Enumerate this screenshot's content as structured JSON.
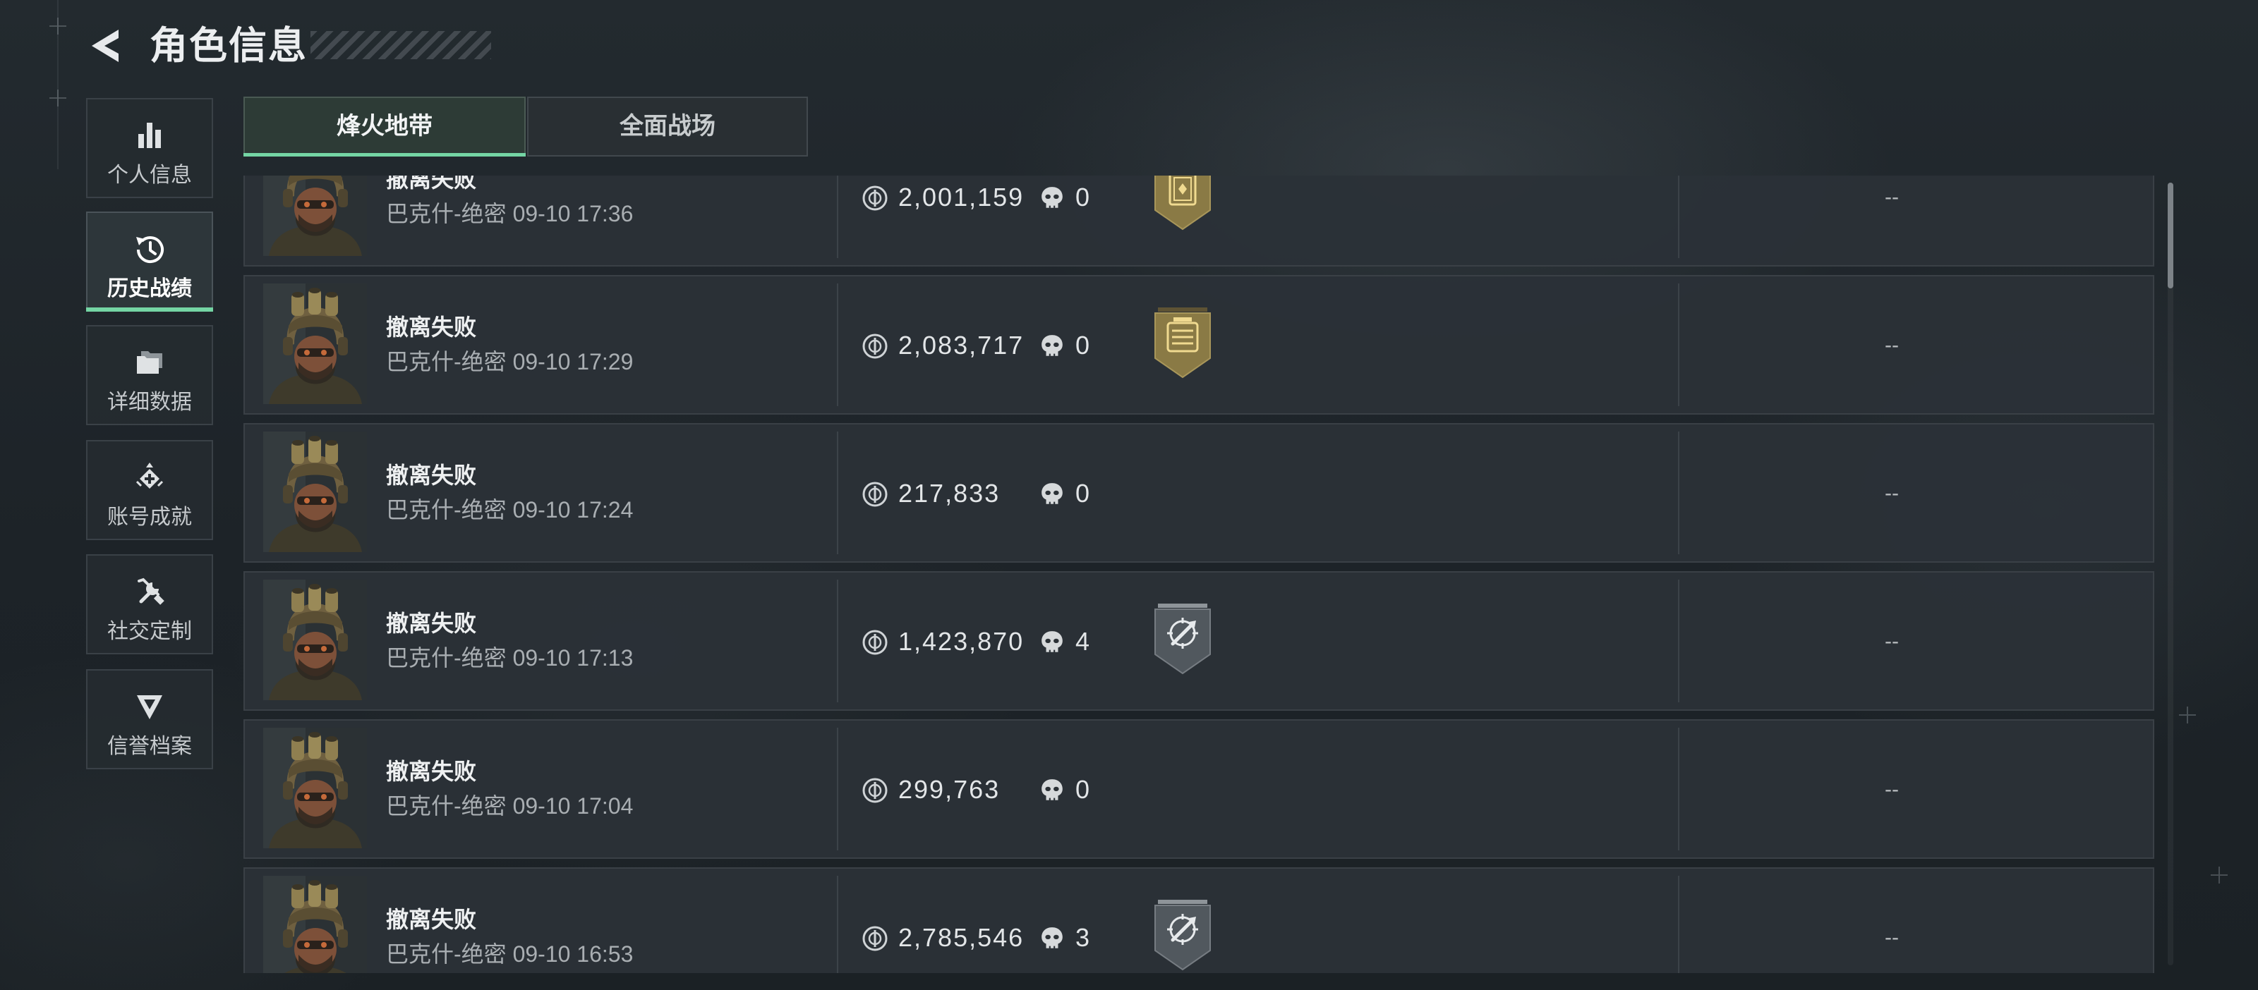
{
  "header": {
    "title": "角色信息",
    "back_icon": "back-arrow-icon"
  },
  "sidebar": {
    "items": [
      {
        "label": "个人信息",
        "icon": "bar-chart-icon",
        "selected": false
      },
      {
        "label": "历史战绩",
        "icon": "history-clock-icon",
        "selected": true
      },
      {
        "label": "详细数据",
        "icon": "folder-icon",
        "selected": false
      },
      {
        "label": "账号成就",
        "icon": "achievement-icon",
        "selected": false
      },
      {
        "label": "社交定制",
        "icon": "tools-icon",
        "selected": false
      },
      {
        "label": "信誉档案",
        "icon": "reputation-icon",
        "selected": false
      }
    ]
  },
  "tabs": [
    {
      "label": "烽火地带",
      "selected": true
    },
    {
      "label": "全面战场",
      "selected": false
    }
  ],
  "row_icons": {
    "value": "coin-icon",
    "kills": "skull-icon"
  },
  "rows": [
    {
      "result": "撤离失败",
      "map": "巴克什-绝密",
      "time": "09-10 17:36",
      "value": "2,001,159",
      "kills": "0",
      "badge": {
        "icon": "gold-card-badge-icon",
        "tone": "gold"
      },
      "extra": "--"
    },
    {
      "result": "撤离失败",
      "map": "巴克什-绝密",
      "time": "09-10 17:29",
      "value": "2,083,717",
      "kills": "0",
      "badge": {
        "icon": "gold-scroll-badge-icon",
        "tone": "gold"
      },
      "extra": "--"
    },
    {
      "result": "撤离失败",
      "map": "巴克什-绝密",
      "time": "09-10 17:24",
      "value": "217,833",
      "kills": "0",
      "badge": null,
      "extra": "--"
    },
    {
      "result": "撤离失败",
      "map": "巴克什-绝密",
      "time": "09-10 17:13",
      "value": "1,423,870",
      "kills": "4",
      "badge": {
        "icon": "crosshair-badge-icon",
        "tone": "gray"
      },
      "extra": "--"
    },
    {
      "result": "撤离失败",
      "map": "巴克什-绝密",
      "time": "09-10 17:04",
      "value": "299,763",
      "kills": "0",
      "badge": null,
      "extra": "--"
    },
    {
      "result": "撤离失败",
      "map": "巴克什-绝密",
      "time": "09-10 16:53",
      "value": "2,785,546",
      "kills": "3",
      "badge": {
        "icon": "crosshair-badge-icon",
        "tone": "gray"
      },
      "extra": "--"
    }
  ],
  "colors": {
    "accent": "#74d5a4",
    "badge_gold": "#8a7a45",
    "badge_gray": "#51585e",
    "text": "#e6e8ea",
    "muted": "#a9aeb2"
  }
}
